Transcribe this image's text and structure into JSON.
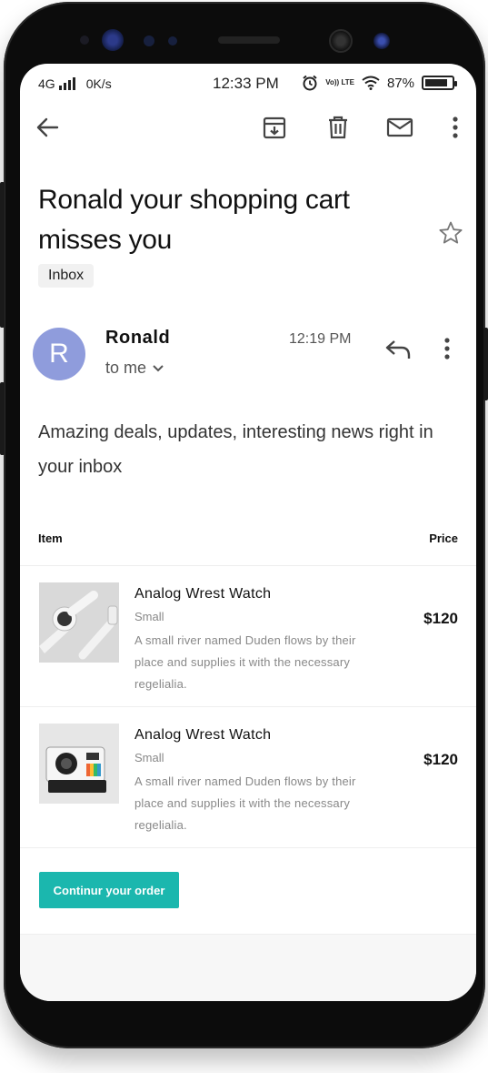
{
  "status_bar": {
    "network": "4G",
    "speed": "0K/s",
    "time": "12:33 PM",
    "volte_label": "Vo)) LTE",
    "battery": "87%",
    "battery_level": 0.87
  },
  "toolbar": {
    "back_icon": "arrow-left-icon",
    "archive_icon": "archive-icon",
    "delete_icon": "trash-icon",
    "mail_icon": "mail-icon",
    "more_icon": "more-vertical-icon"
  },
  "email": {
    "subject": "Ronald your shopping cart misses you",
    "label": "Inbox",
    "sender_initial": "R",
    "sender_name": "Ronald",
    "recipient": "to me",
    "sent_time": "12:19 PM",
    "intro": "Amazing deals, updates, interesting news right in your inbox"
  },
  "table": {
    "col_item": "Item",
    "col_price": "Price",
    "rows": [
      {
        "title": "Analog Wrest Watch",
        "size": "Small",
        "description": "A small river named Duden flows by their place and supplies it with the necessary regelialia.",
        "price": "$120",
        "image": "watch-photo"
      },
      {
        "title": "Analog Wrest Watch",
        "size": "Small",
        "description": "A small river named Duden flows by their place and supplies it with the necessary regelialia.",
        "price": "$120",
        "image": "camera-photo"
      }
    ]
  },
  "cta_label": "Continur your order",
  "colors": {
    "accent": "#1bb7ae",
    "avatar": "#8f9cdc"
  }
}
